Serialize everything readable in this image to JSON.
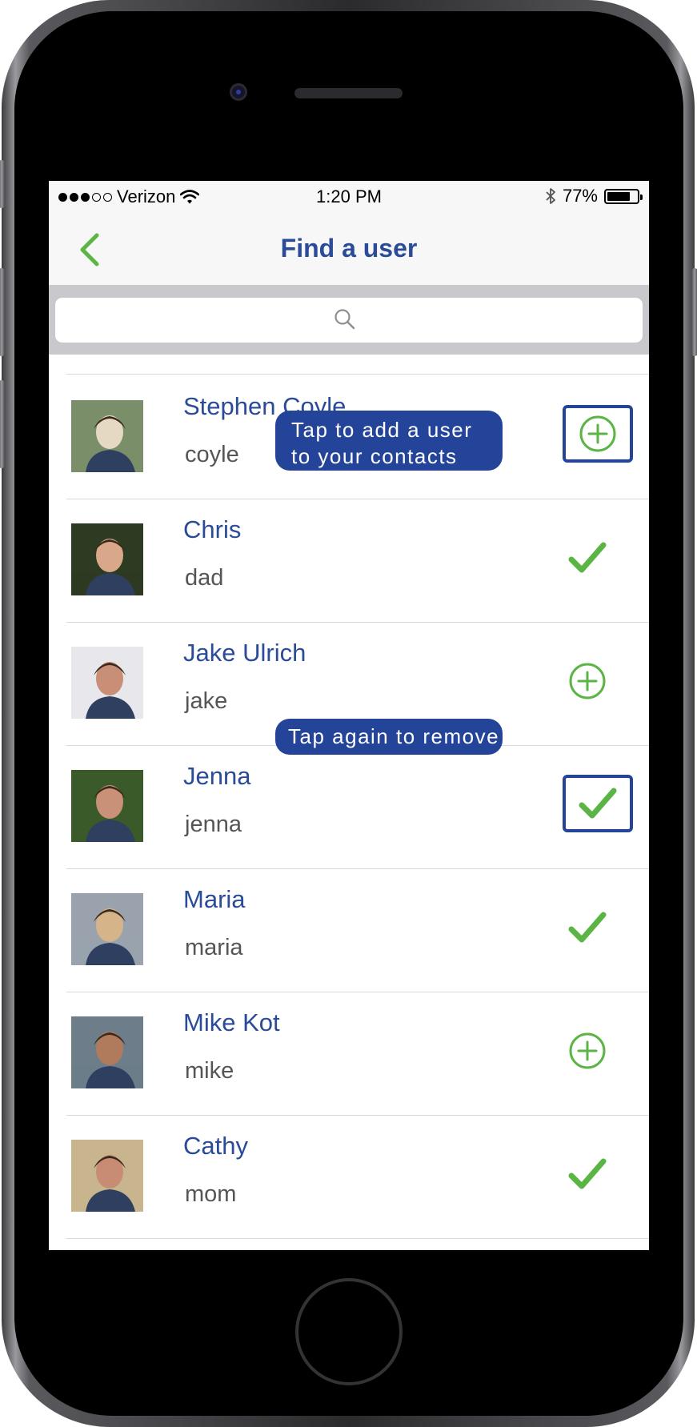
{
  "status_bar": {
    "carrier": "Verizon",
    "time": "1:20 PM",
    "battery": "77%",
    "battery_level": 0.77,
    "signal_bars_filled": 3,
    "signal_bars_total": 5
  },
  "nav": {
    "title": "Find a user",
    "back_icon": "chevron-left-icon"
  },
  "search": {
    "placeholder": "",
    "icon": "search-icon"
  },
  "users": [
    {
      "name": "Stephen Coyle",
      "handle": "coyle",
      "status": "add",
      "highlighted": true,
      "avatar_colors": [
        "#7b8e6a",
        "#e6d9c4"
      ]
    },
    {
      "name": "Chris",
      "handle": "dad",
      "status": "added",
      "highlighted": false,
      "avatar_colors": [
        "#2d3b22",
        "#d9a78a"
      ]
    },
    {
      "name": "Jake Ulrich",
      "handle": "jake",
      "status": "add",
      "highlighted": false,
      "avatar_colors": [
        "#e8e8ec",
        "#c88f76"
      ]
    },
    {
      "name": "Jenna",
      "handle": "jenna",
      "status": "added",
      "highlighted": true,
      "avatar_colors": [
        "#3a5a2a",
        "#c99177"
      ]
    },
    {
      "name": "Maria",
      "handle": "maria",
      "status": "added",
      "highlighted": false,
      "avatar_colors": [
        "#9aa3ad",
        "#d6b48a"
      ]
    },
    {
      "name": "Mike Kot",
      "handle": "mike",
      "status": "add",
      "highlighted": false,
      "avatar_colors": [
        "#6d7d8a",
        "#b07b5c"
      ]
    },
    {
      "name": "Cathy",
      "handle": "mom",
      "status": "added",
      "highlighted": false,
      "avatar_colors": [
        "#c9b58d",
        "#c78c73"
      ]
    }
  ],
  "tooltips": {
    "add": "Tap to add a user to your contacts",
    "remove": "Tap again to remove"
  },
  "colors": {
    "accent_blue": "#2a4b98",
    "tooltip_blue": "#24449a",
    "action_green": "#5bb544",
    "nav_back_green": "#5bb544"
  }
}
